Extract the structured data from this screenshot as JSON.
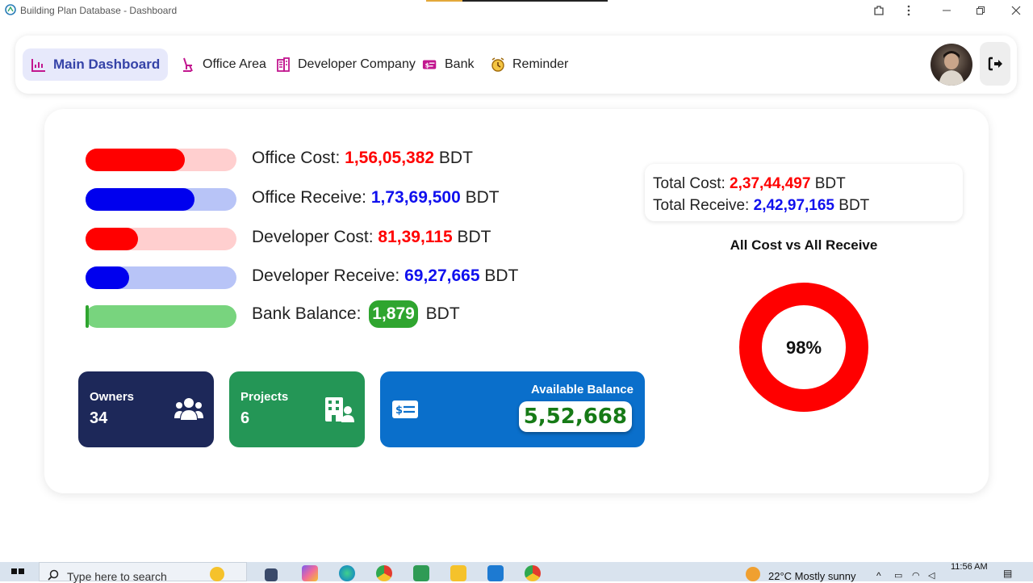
{
  "window": {
    "title": "Building Plan Database - Dashboard"
  },
  "nav": {
    "items": [
      {
        "label": "Main Dashboard",
        "icon": "chart-icon",
        "active": true
      },
      {
        "label": "Office Area",
        "icon": "office-chair-icon",
        "active": false
      },
      {
        "label": "Developer Company",
        "icon": "building-icon",
        "active": false
      },
      {
        "label": "Bank",
        "icon": "money-transfer-icon",
        "active": false
      },
      {
        "label": "Reminder",
        "icon": "alarm-clock-icon",
        "active": false
      }
    ]
  },
  "metrics": [
    {
      "label": "Office Cost: ",
      "value": "1,56,05,382",
      "unit": " BDT",
      "color": "#ff0000",
      "track": "#ffcfcf",
      "fraction": 0.66
    },
    {
      "label": "Office Receive: ",
      "value": "1,73,69,500",
      "unit": " BDT",
      "color": "#0000ee",
      "track": "#b8c4f7",
      "fraction": 0.72
    },
    {
      "label": "Developer Cost: ",
      "value": "81,39,115",
      "unit": " BDT",
      "color": "#ff0000",
      "track": "#ffcfcf",
      "fraction": 0.35
    },
    {
      "label": "Developer Receive: ",
      "value": "69,27,665",
      "unit": " BDT",
      "color": "#0000ee",
      "track": "#b8c4f7",
      "fraction": 0.29
    },
    {
      "label": "Bank Balance: ",
      "value": "1,879",
      "unit": " BDT",
      "color": "#2fa52f",
      "track": "#78d47e",
      "fraction": 0.01
    }
  ],
  "stats": {
    "owners": {
      "label": "Owners",
      "value": "34",
      "color": "#1d2859"
    },
    "projects": {
      "label": "Projects",
      "value": "6",
      "color": "#249656"
    },
    "available": {
      "label": "Available Balance",
      "value": "5,52,668",
      "color": "#0a6fcb"
    }
  },
  "totals": {
    "cost_label": "Total Cost: ",
    "cost_value": "2,37,44,497",
    "receive_label": "Total Receive: ",
    "receive_value": "2,42,97,165",
    "unit": " BDT"
  },
  "chart_data": {
    "type": "pie",
    "title": "All Cost vs All Receive",
    "center_label": "98%",
    "values": [
      98
    ],
    "color": "#ff0000"
  },
  "taskbar": {
    "search_placeholder": "Type here to search",
    "weather": "22°C  Mostly sunny",
    "time": "11:56 AM"
  }
}
